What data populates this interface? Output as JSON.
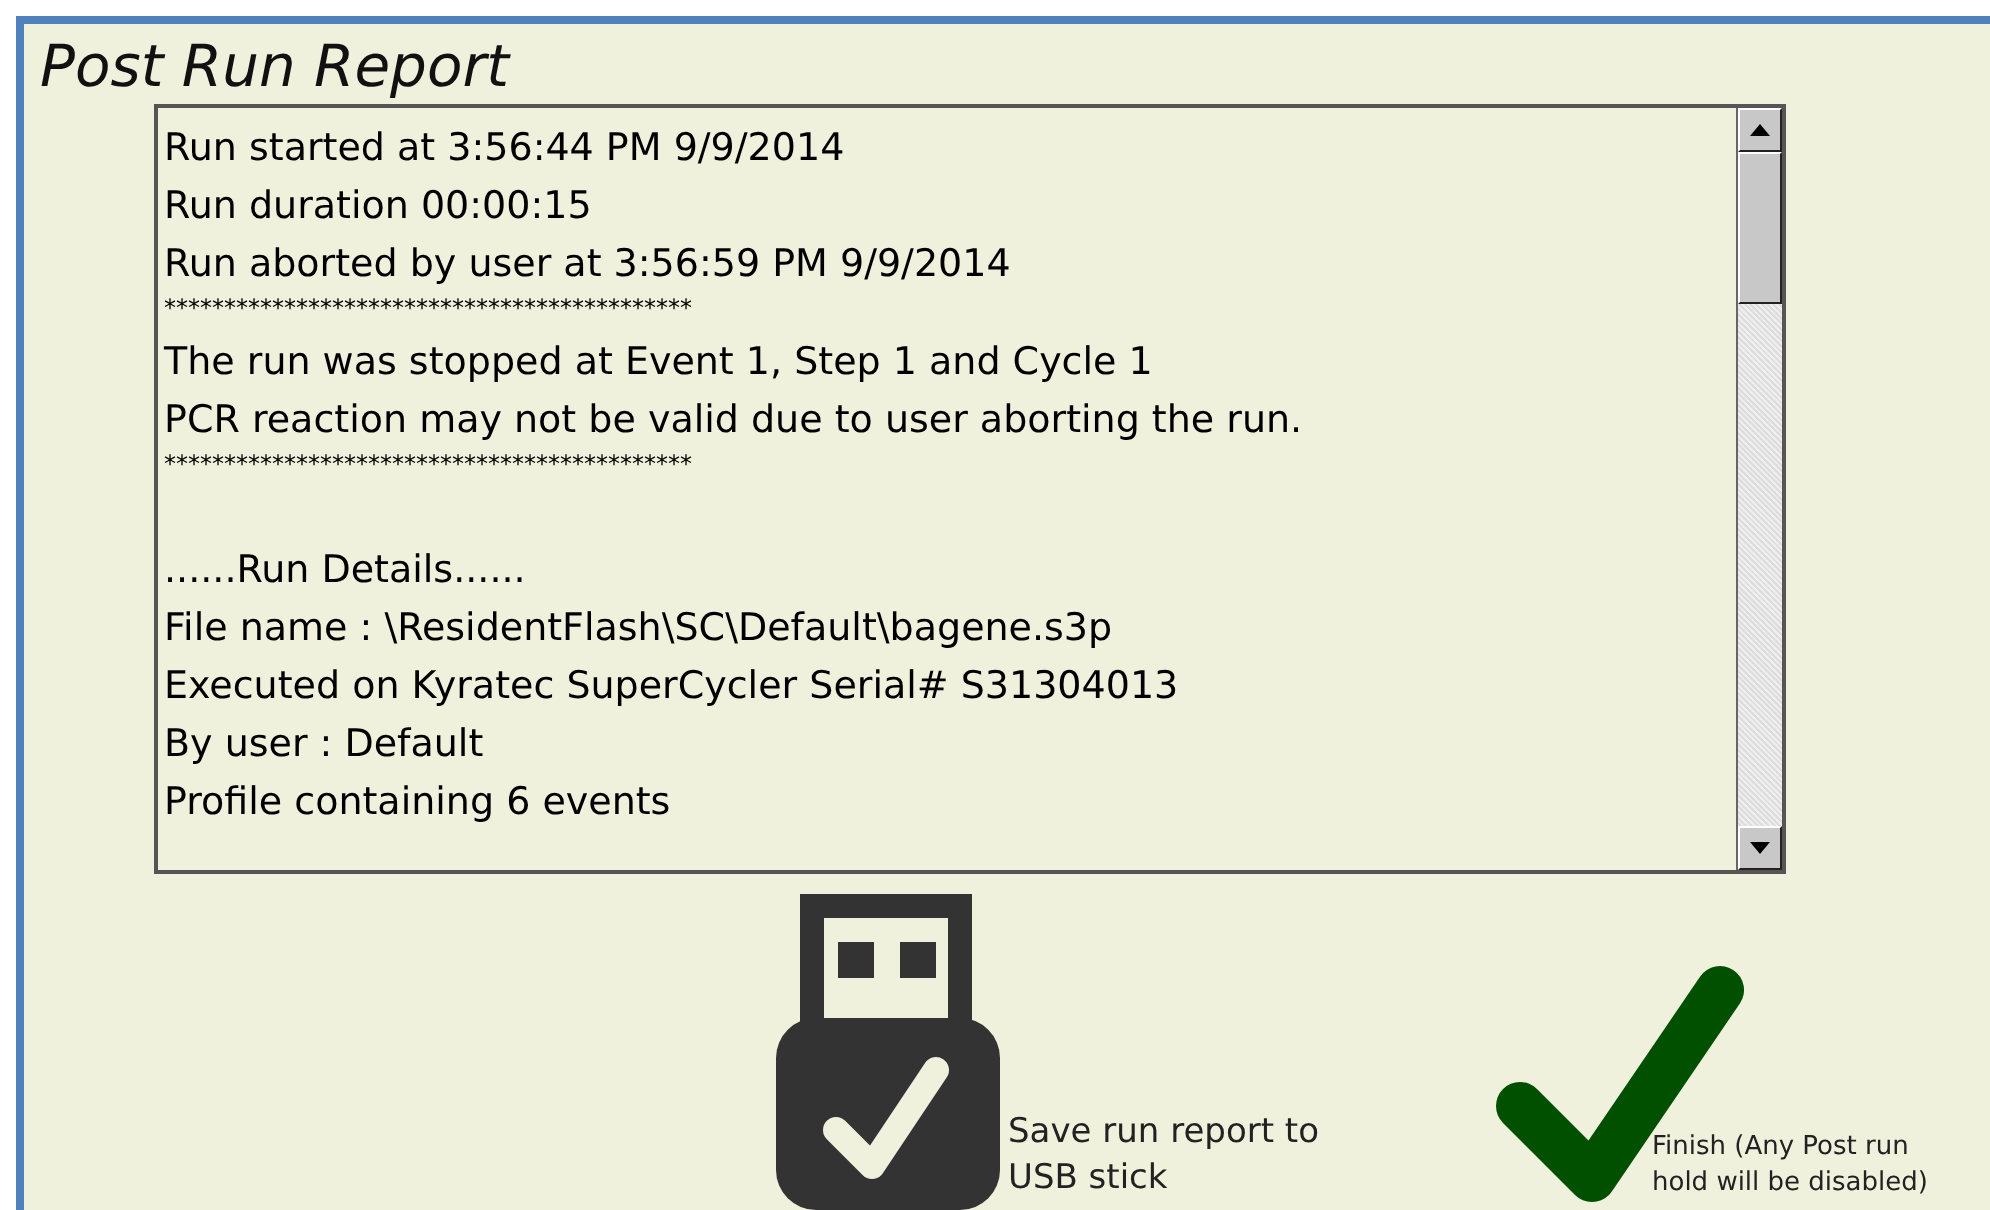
{
  "title": "Post Run Report",
  "report": {
    "sections": [
      {
        "lines": [
          {
            "kind": "text",
            "text": "Run started at 3:56:44 PM 9/9/2014"
          },
          {
            "kind": "text",
            "text": "Run duration 00:00:15"
          },
          {
            "kind": "text",
            "text": "Run aborted by user at 3:56:59 PM 9/9/2014"
          },
          {
            "kind": "rule",
            "text": "********************************************"
          }
        ]
      },
      {
        "lines": [
          {
            "kind": "text",
            "text": "The run was stopped at Event 1, Step 1 and Cycle 1"
          },
          {
            "kind": "text",
            "text": "PCR reaction may not be valid due to user aborting the run."
          },
          {
            "kind": "rule",
            "text": "********************************************"
          }
        ]
      },
      {
        "lines": [
          {
            "kind": "text",
            "text": "......Run Details......"
          },
          {
            "kind": "text",
            "text": "File name : \\ResidentFlash\\SC\\Default\\bagene.s3p"
          },
          {
            "kind": "text",
            "text": "Executed on Kyratec SuperCycler Serial# S31304013"
          },
          {
            "kind": "text",
            "text": "By user : Default"
          },
          {
            "kind": "text",
            "text": "Profile containing 6 events"
          }
        ]
      }
    ]
  },
  "actions": [
    {
      "kind": "usb",
      "label": "Save run report to USB stick"
    },
    {
      "kind": "finish",
      "label": "Finish (Any Post run hold will be disabled)"
    }
  ]
}
